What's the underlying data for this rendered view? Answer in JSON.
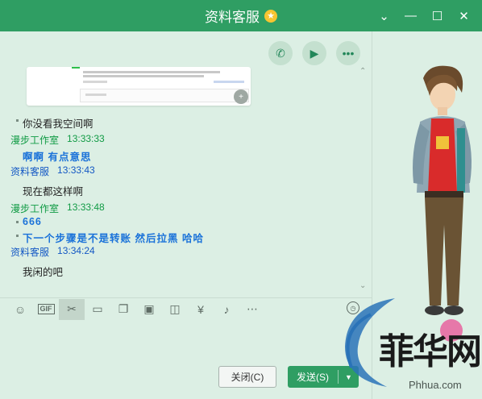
{
  "window": {
    "title": "资料客服",
    "title_badge_icon": "star-badge-icon",
    "controls": [
      "chevron-down-icon",
      "minimize-icon",
      "maximize-icon",
      "close-icon"
    ]
  },
  "call_bar": [
    "phone-icon",
    "video-icon",
    "more-icon"
  ],
  "messages": [
    {
      "type": "text",
      "text": "你没看我空间啊"
    },
    {
      "type": "header",
      "sender": "漫步工作室",
      "time": "13:33:33",
      "color": "#119b45"
    },
    {
      "type": "text",
      "text": "啊啊    有点意思",
      "style": "bold-blue"
    },
    {
      "type": "header",
      "sender": "资料客服",
      "time": "13:33:43",
      "color": "#1458c4"
    },
    {
      "type": "text",
      "text": "现在都这样啊"
    },
    {
      "type": "header",
      "sender": "漫步工作室",
      "time": "13:33:48",
      "color": "#119b45"
    },
    {
      "type": "text",
      "text": "666",
      "style": "bold-blue"
    },
    {
      "type": "text",
      "text": "下一个步骤是不是转账  然后拉黑  哈哈",
      "style": "bold-blue"
    },
    {
      "type": "header",
      "sender": "资料客服",
      "time": "13:34:24",
      "color": "#1458c4"
    },
    {
      "type": "text",
      "text": "我闲的吧"
    }
  ],
  "toolbar": {
    "gif_label": "GIF",
    "items": [
      "emoji-icon",
      "gif-icon",
      "scissors-icon",
      "folder-icon",
      "file-icon",
      "image-icon",
      "shake-icon",
      "red-packet-icon",
      "music-icon",
      "more-tools-icon"
    ],
    "history": "history-icon"
  },
  "actions": {
    "close_label": "关闭(C)",
    "send_label": "发送(S)"
  },
  "watermark": {
    "text": "菲华网",
    "url": "Phhua.com"
  },
  "colors": {
    "titlebar": "#2f9e63",
    "background": "#dcefe4",
    "accent": "#2f9e63"
  }
}
